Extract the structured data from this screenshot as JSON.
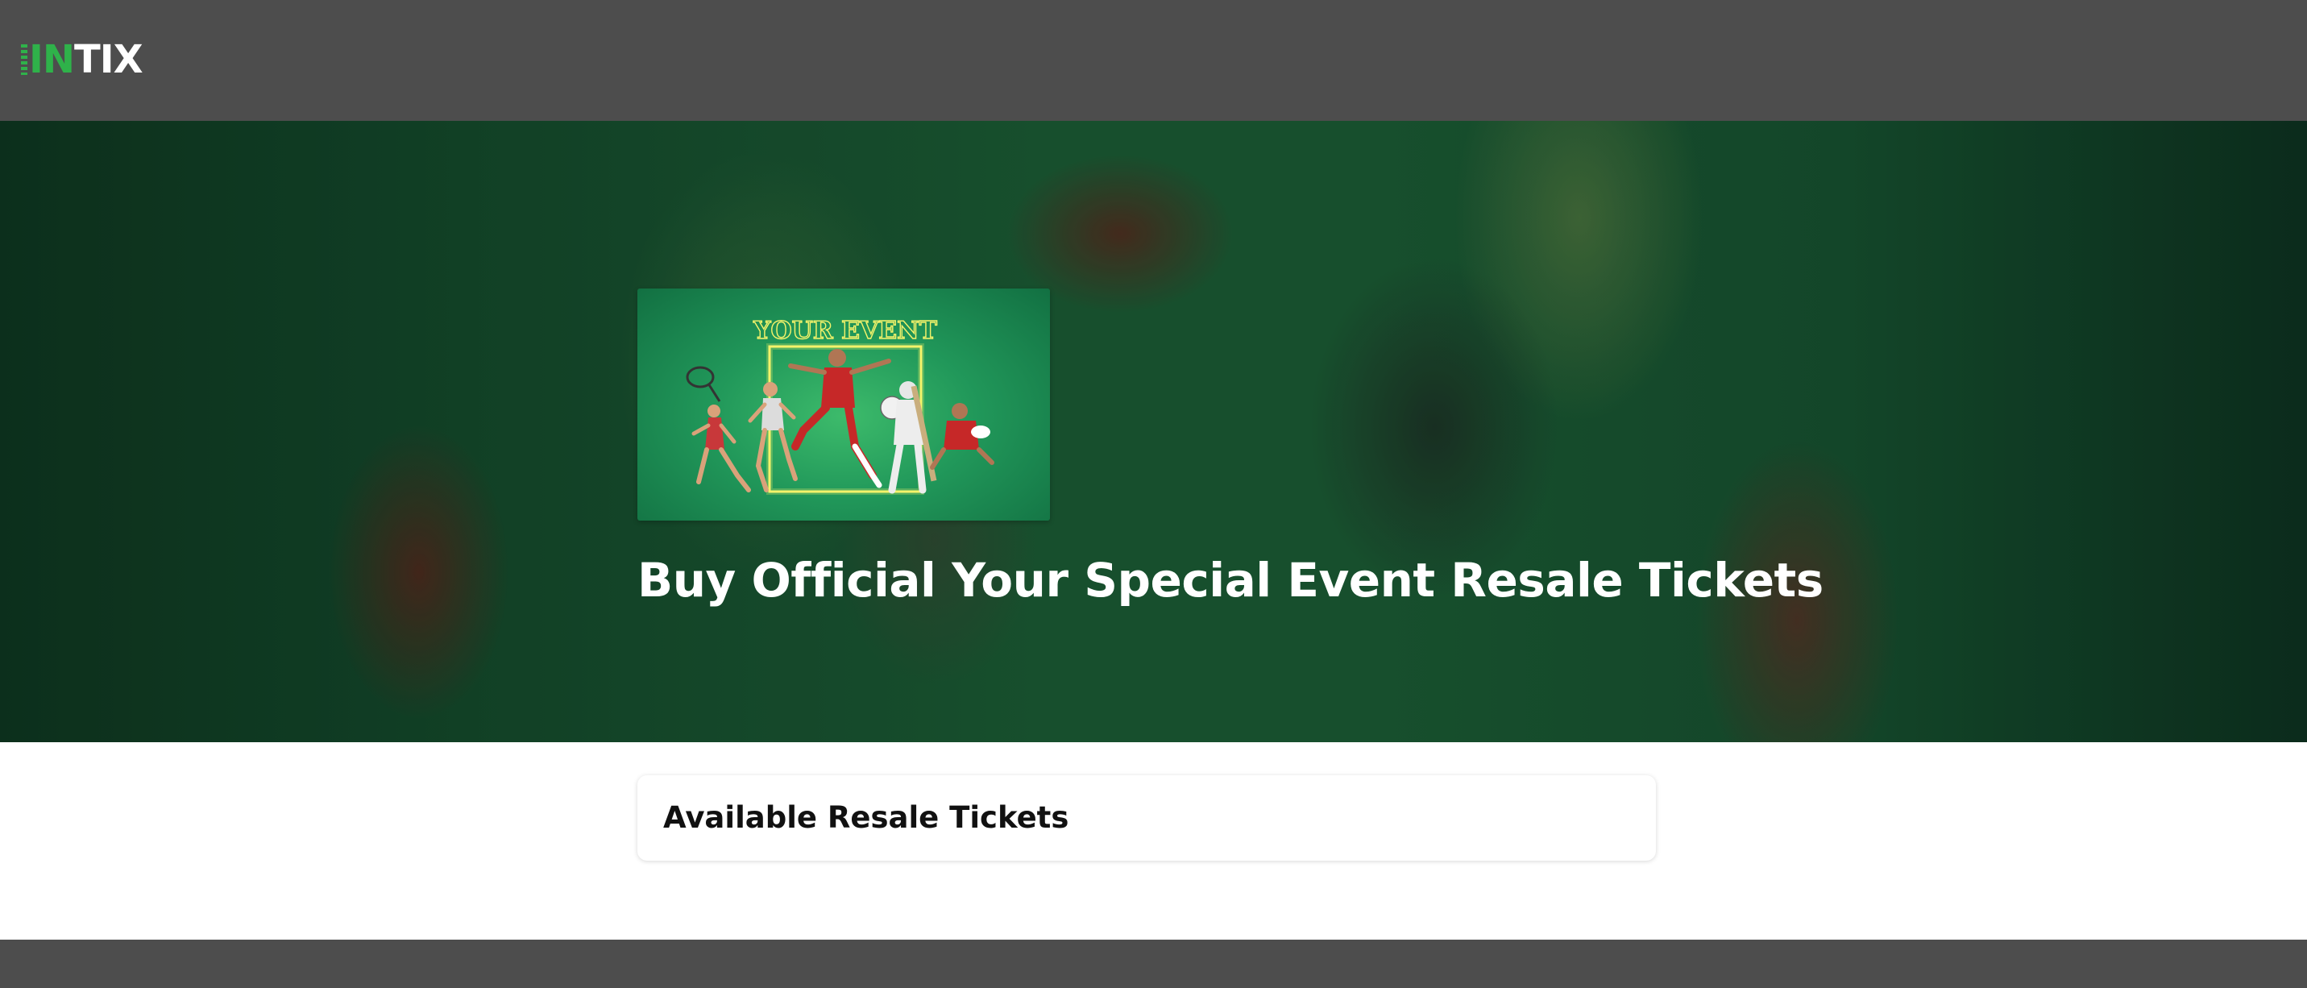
{
  "header": {
    "logo": {
      "icon": "ticket-stub-icon",
      "part1": "IN",
      "part2": "TIX",
      "color_primary": "#2fb24a"
    }
  },
  "hero": {
    "event_image": {
      "caption_text": "YOUR EVENT"
    },
    "title": "Buy Official Your Special Event Resale Tickets"
  },
  "tickets_section": {
    "title": "Available Resale Tickets"
  },
  "colors": {
    "header_bg": "#4d4d4d",
    "hero_bg": "#1b5a34",
    "footer_bg": "#4d4d4d"
  }
}
